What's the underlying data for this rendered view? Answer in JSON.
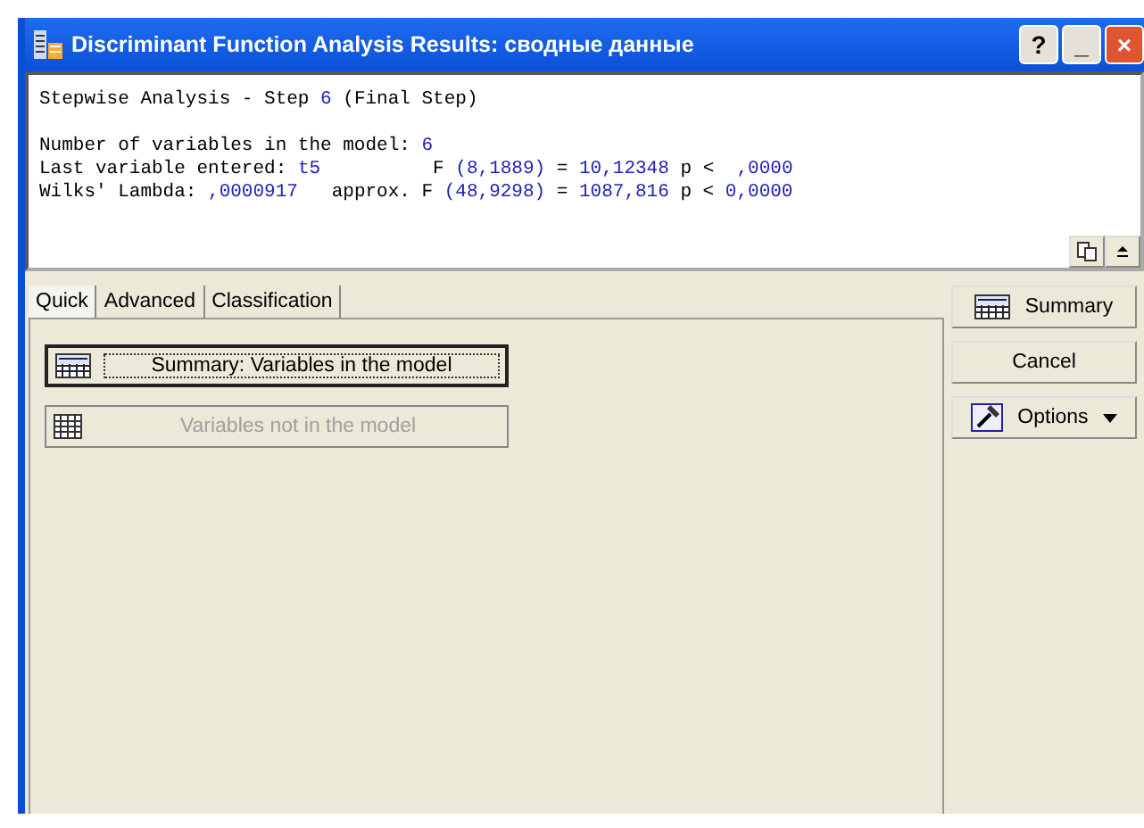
{
  "window": {
    "title": "Discriminant Function Analysis Results: сводные данные",
    "controls": [
      "?",
      "_",
      "×"
    ]
  },
  "results": [
    [
      {
        "kind": "label",
        "text": "Stepwise Analysis - Step "
      },
      {
        "kind": "value",
        "text": "6"
      },
      {
        "kind": "label",
        "text": " (Final Step)"
      }
    ],
    [
      {
        "kind": "label",
        "text": "Number of variables in the model: "
      },
      {
        "kind": "value",
        "text": "6"
      }
    ],
    [
      {
        "kind": "label",
        "text": "Last variable entered: "
      },
      {
        "kind": "value",
        "text": "t5"
      },
      {
        "kind": "label",
        "text": "          F "
      },
      {
        "kind": "value",
        "text": "(8,1889)"
      },
      {
        "kind": "label",
        "text": " = "
      },
      {
        "kind": "value",
        "text": "10,12348"
      },
      {
        "kind": "label",
        "text": " p <  "
      },
      {
        "kind": "value",
        "text": ",0000"
      }
    ],
    [
      {
        "kind": "label",
        "text": "Wilks' Lambda: "
      },
      {
        "kind": "value",
        "text": ",0000917"
      },
      {
        "kind": "label",
        "text": "   approx. F "
      },
      {
        "kind": "value",
        "text": "(48,9298)"
      },
      {
        "kind": "label",
        "text": " = "
      },
      {
        "kind": "value",
        "text": "1087,816"
      },
      {
        "kind": "label",
        "text": " p < "
      },
      {
        "kind": "value",
        "text": "0,0000"
      }
    ]
  ],
  "tabs": [
    {
      "label": "Quick",
      "selected": true
    },
    {
      "label": "Advanced",
      "selected": false
    },
    {
      "label": "Classification",
      "selected": false
    }
  ],
  "quick_buttons": [
    {
      "label": "Summary:  Variables in the model",
      "kind": "summary",
      "disabled": false,
      "focused": true
    },
    {
      "label": "Variables not in the model",
      "kind": "grid",
      "disabled": true,
      "focused": false
    }
  ],
  "side_buttons": [
    {
      "label": "Summary",
      "kind": "summary",
      "dropdown": false
    },
    {
      "label": "Cancel",
      "kind": "plain",
      "dropdown": false
    },
    {
      "label": "Options",
      "kind": "options",
      "dropdown": true
    }
  ]
}
